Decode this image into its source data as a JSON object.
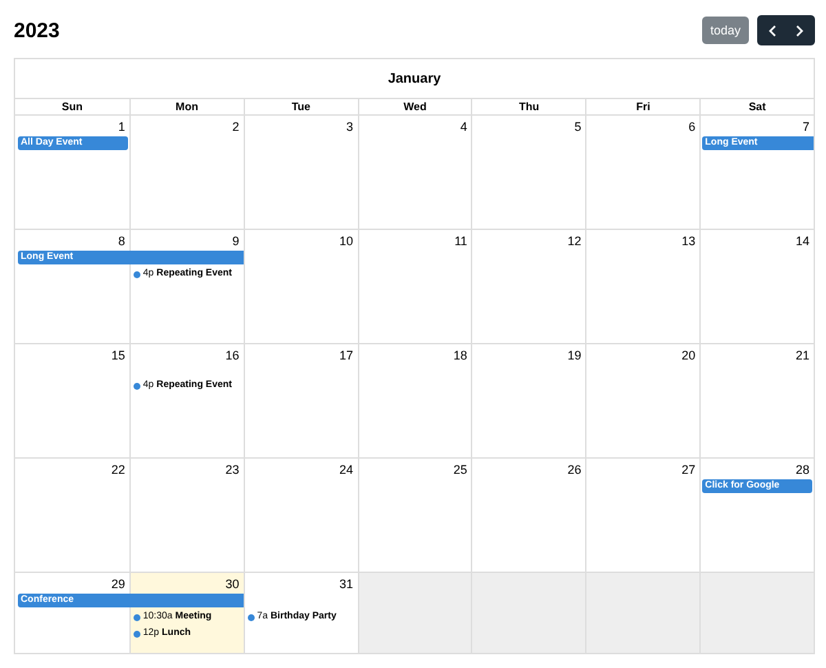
{
  "title": "2023",
  "toolbar": {
    "today_button": {
      "label": "today",
      "disabled": true
    }
  },
  "month_title": "January",
  "weekdays": [
    "Sun",
    "Mon",
    "Tue",
    "Wed",
    "Thu",
    "Fri",
    "Sat"
  ],
  "weeks": [
    {
      "days": [
        {
          "number": "1",
          "today": false,
          "other_month": false,
          "events": [
            {
              "kind": "bar",
              "title": "All Day Event",
              "continues": false
            }
          ]
        },
        {
          "number": "2",
          "today": false,
          "other_month": false
        },
        {
          "number": "3",
          "today": false,
          "other_month": false
        },
        {
          "number": "4",
          "today": false,
          "other_month": false
        },
        {
          "number": "5",
          "today": false,
          "other_month": false
        },
        {
          "number": "6",
          "today": false,
          "other_month": false
        },
        {
          "number": "7",
          "today": false,
          "other_month": false,
          "events": [
            {
              "kind": "bar",
              "title": "Long Event",
              "continues": true
            }
          ]
        }
      ]
    },
    {
      "days": [
        {
          "number": "8",
          "today": false,
          "other_month": false,
          "events": [
            {
              "kind": "bar",
              "title": "Long Event",
              "continues": true
            }
          ]
        },
        {
          "number": "9",
          "today": false,
          "other_month": false,
          "events": [
            {
              "kind": "timed",
              "time": "4p",
              "title": "Repeating Event"
            }
          ]
        },
        {
          "number": "10",
          "today": false,
          "other_month": false
        },
        {
          "number": "11",
          "today": false,
          "other_month": false
        },
        {
          "number": "12",
          "today": false,
          "other_month": false
        },
        {
          "number": "13",
          "today": false,
          "other_month": false
        },
        {
          "number": "14",
          "today": false,
          "other_month": false
        }
      ]
    },
    {
      "days": [
        {
          "number": "15",
          "today": false,
          "other_month": false
        },
        {
          "number": "16",
          "today": false,
          "other_month": false,
          "events": [
            {
              "kind": "timed",
              "time": "4p",
              "title": "Repeating Event"
            }
          ]
        },
        {
          "number": "17",
          "today": false,
          "other_month": false
        },
        {
          "number": "18",
          "today": false,
          "other_month": false
        },
        {
          "number": "19",
          "today": false,
          "other_month": false
        },
        {
          "number": "20",
          "today": false,
          "other_month": false
        },
        {
          "number": "21",
          "today": false,
          "other_month": false
        }
      ]
    },
    {
      "days": [
        {
          "number": "22",
          "today": false,
          "other_month": false
        },
        {
          "number": "23",
          "today": false,
          "other_month": false
        },
        {
          "number": "24",
          "today": false,
          "other_month": false
        },
        {
          "number": "25",
          "today": false,
          "other_month": false
        },
        {
          "number": "26",
          "today": false,
          "other_month": false
        },
        {
          "number": "27",
          "today": false,
          "other_month": false
        },
        {
          "number": "28",
          "today": false,
          "other_month": false,
          "events": [
            {
              "kind": "bar",
              "title": "Click for Google",
              "continues": false
            }
          ]
        }
      ]
    },
    {
      "days": [
        {
          "number": "29",
          "today": false,
          "other_month": false,
          "events": [
            {
              "kind": "bar",
              "title": "Conference",
              "continues": true
            }
          ]
        },
        {
          "number": "30",
          "today": true,
          "other_month": false,
          "events": [
            {
              "kind": "timed",
              "time": "10:30a",
              "title": "Meeting"
            },
            {
              "kind": "timed",
              "time": "12p",
              "title": "Lunch"
            }
          ]
        },
        {
          "number": "31",
          "today": false,
          "other_month": false,
          "events": [
            {
              "kind": "timed",
              "time": "7a",
              "title": "Birthday Party"
            }
          ]
        },
        {
          "today": false,
          "other_month": true
        },
        {
          "today": false,
          "other_month": true
        },
        {
          "today": false,
          "other_month": true
        },
        {
          "today": false,
          "other_month": true
        }
      ]
    }
  ]
}
